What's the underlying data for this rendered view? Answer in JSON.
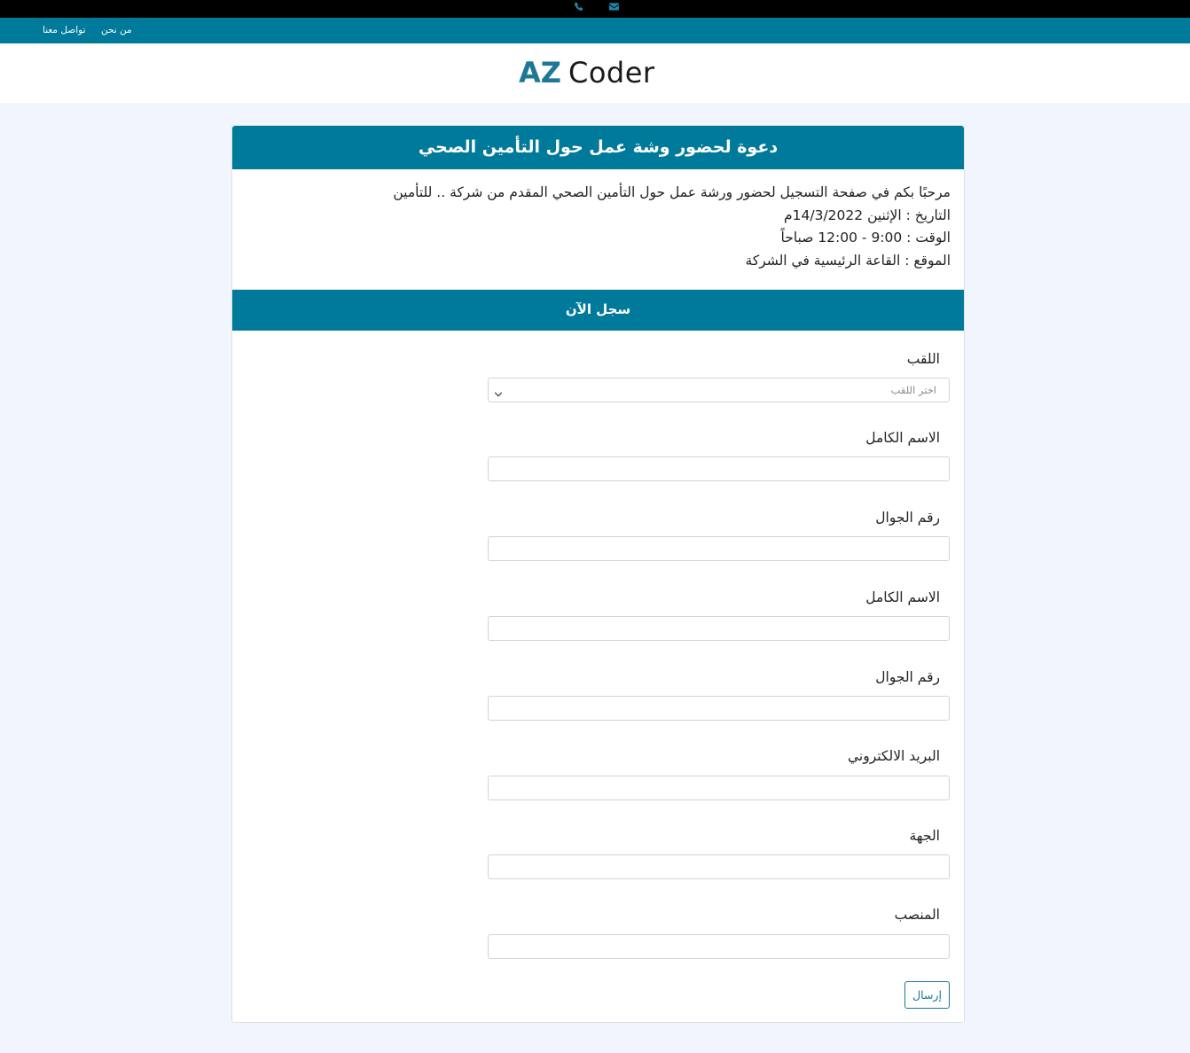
{
  "topbar": {
    "icons": [
      "phone-icon",
      "envelope-icon"
    ],
    "icon_color": "#1a86a8"
  },
  "navbar": {
    "background": "#007a9a",
    "links": [
      "من نحن",
      "تواصل معنا"
    ]
  },
  "brand": {
    "logo_az": "AZ",
    "logo_coder": "Coder"
  },
  "header": {
    "title": "دعوة لحضور وشة عمل حول التأمين الصحي"
  },
  "intro": {
    "welcome": "مرحبًا بكم في صفحة التسجيل لحضور ورشة عمل حول التأمين الصحي المقدم من شركة .. للتأمين",
    "date": "التاريخ : الإثنين 14/3/2022م",
    "time": "الوقت : 9:00 - 12:00 صباحاً",
    "location": "الموقع : القاعة الرئيسية في الشركة"
  },
  "form": {
    "section_title": "سجل الآن",
    "title_label": "اللقب",
    "title_placeholder": "اختر اللقب",
    "fields": [
      {
        "label": "الاسم الكامل",
        "value": ""
      },
      {
        "label": "رقم الجوال",
        "value": ""
      },
      {
        "label": "الاسم الكامل",
        "value": ""
      },
      {
        "label": "رقم الجوال",
        "value": ""
      },
      {
        "label": "البريد الالكتروني",
        "value": ""
      },
      {
        "label": "الجهة",
        "value": ""
      },
      {
        "label": "المنصب",
        "value": ""
      }
    ],
    "submit_label": "إرسال"
  },
  "colors": {
    "primary": "#007a9a",
    "page_background": "#f1f5fd",
    "topbar": "#000000"
  }
}
